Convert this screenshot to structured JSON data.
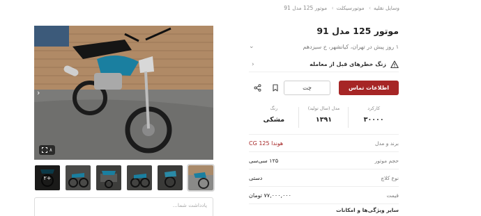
{
  "breadcrumb": [
    "وسایل نقلیه",
    "موتورسیکلت",
    "موتور 125 مدل 91"
  ],
  "listing": {
    "title": "موتور 125 مدل 91",
    "subtitle": "۱ روز پیش در تهران، کیانشهر، خ سیزدهم",
    "warning": "زنگ خطرهای قبل از معامله"
  },
  "actions": {
    "contact": "اطلاعات تماس",
    "chat": "چت"
  },
  "icons": {
    "warning": "warning-triangle-icon",
    "bookmark": "bookmark-icon",
    "share": "share-icon",
    "chevron": "chevron-left-icon",
    "gallery": "gallery-expand-icon"
  },
  "specs": [
    {
      "label": "کارکرد",
      "value": "۳۰۰۰۰"
    },
    {
      "label": "مدل (سال تولید)",
      "value": "۱۳۹۱"
    },
    {
      "label": "رنگ",
      "value": "مشکی"
    }
  ],
  "details": [
    {
      "label": "برند و مدل",
      "value": "هوندا CG 125",
      "link": true
    },
    {
      "label": "حجم موتور",
      "value": "۱۲۵ سی‌سی"
    },
    {
      "label": "نوع کلاچ",
      "value": "دستی"
    },
    {
      "label": "قیمت",
      "value": "۷۷,۰۰۰,۰۰۰ تومان"
    }
  ],
  "more_features": "سایر ویژگی‌ها و امکانات",
  "gallery": {
    "count": "۸",
    "more_label": "+۲"
  },
  "note_placeholder": "یادداشت شما...",
  "colors": {
    "accent": "#a62626"
  }
}
